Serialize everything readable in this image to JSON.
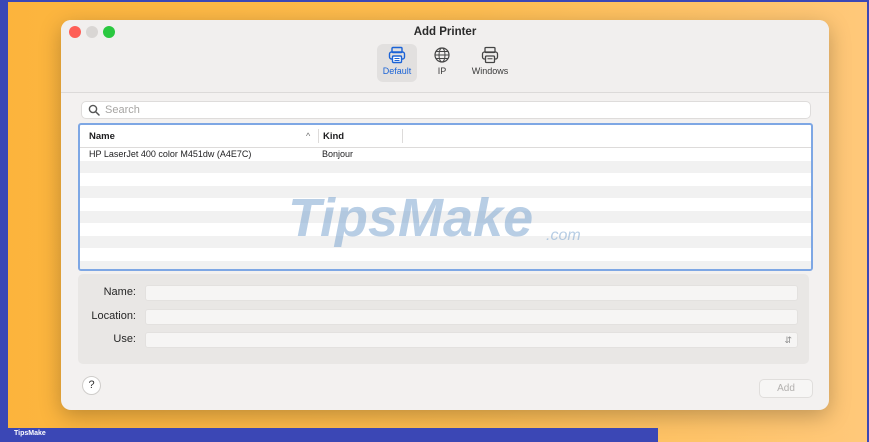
{
  "window": {
    "title": "Add Printer"
  },
  "toolbar": {
    "items": [
      {
        "label": "Default",
        "icon": "printer-icon",
        "selected": true
      },
      {
        "label": "IP",
        "icon": "globe-icon",
        "selected": false
      },
      {
        "label": "Windows",
        "icon": "windows-printer-icon",
        "selected": false
      }
    ]
  },
  "search": {
    "placeholder": "Search",
    "value": ""
  },
  "table": {
    "columns": {
      "name": "Name",
      "kind": "Kind",
      "sort_indicator": "^"
    },
    "rows": [
      {
        "name": "HP LaserJet 400 color M451dw (A4E7C)",
        "kind": "Bonjour"
      }
    ]
  },
  "form": {
    "name_label": "Name:",
    "location_label": "Location:",
    "use_label": "Use:",
    "name_value": "",
    "location_value": "",
    "use_value": ""
  },
  "buttons": {
    "help": "?",
    "add": "Add"
  },
  "watermark": {
    "main": "TipsMake",
    "suffix": ".com"
  },
  "footer": {
    "text": "TipsMake"
  },
  "colors": {
    "accent": "#1b63d6",
    "table_focus": "#7ea7e4",
    "background": "#fdbd52",
    "frame": "#3b47b5"
  }
}
